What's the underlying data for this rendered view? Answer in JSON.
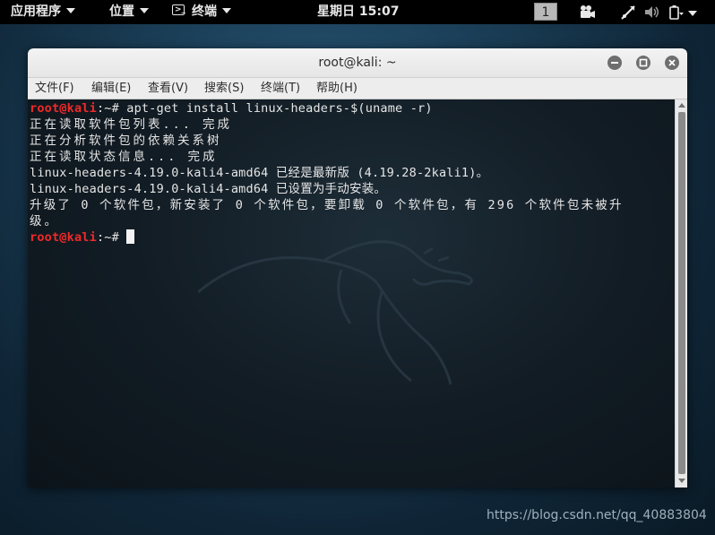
{
  "topbar": {
    "apps_label": "应用程序",
    "places_label": "位置",
    "terminal_label": "终端",
    "clock": "星期日 15:07",
    "workspace": "1",
    "icons": [
      "video-camera-icon",
      "network-icon",
      "volume-icon",
      "battery-icon"
    ]
  },
  "window": {
    "title": "root@kali: ~",
    "controls": [
      "minimize-icon",
      "maximize-icon",
      "close-icon"
    ],
    "menu": {
      "file": "文件(F)",
      "edit": "编辑(E)",
      "view": "查看(V)",
      "search": "搜索(S)",
      "terminal": "终端(T)",
      "help": "帮助(H)"
    }
  },
  "terminal": {
    "prompt_user": "root@kali",
    "prompt_rest": ":~# ",
    "command": "apt-get install linux-headers-$(uname -r)",
    "out1": "正在读取软件包列表... 完成",
    "out2": "正在分析软件包的依赖关系树",
    "out3": "正在读取状态信息... 完成",
    "out4": "linux-headers-4.19.0-kali4-amd64 已经是最新版 (4.19.28-2kali1)。",
    "out5": "linux-headers-4.19.0-kali4-amd64 已设置为手动安装。",
    "out6": "升级了 0 个软件包，新安装了 0 个软件包，要卸载 0 个软件包，有 296 个软件包未被升",
    "out7": "级。",
    "prompt2_user": "root@kali",
    "prompt2_rest": ":~# "
  },
  "watermark": "https://blog.csdn.net/qq_40883804",
  "colors": {
    "prompt_red": "#ef2929",
    "terminal_bg": "#121c24",
    "topbar_bg": "#000000"
  }
}
